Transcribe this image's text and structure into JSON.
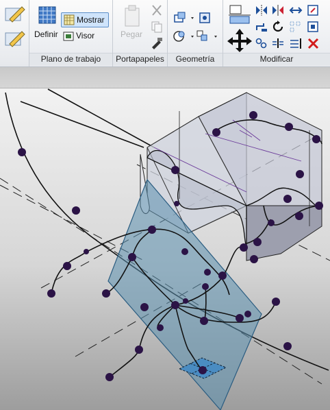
{
  "ribbon": {
    "panels": {
      "workplane": {
        "label": "Plano de trabajo",
        "define_label": "Definir",
        "show_label": "Mostrar",
        "viewer_label": "Visor"
      },
      "clipboard": {
        "label": "Portapapeles",
        "paste_label": "Pegar"
      },
      "geometry": {
        "label": "Geometría"
      },
      "modify": {
        "label": "Modificar"
      }
    }
  },
  "icons": [
    "grid-workplane-icon",
    "show-workplane-icon",
    "viewer-icon",
    "paste-icon",
    "cut-icon",
    "copy-icon",
    "match-type-icon",
    "join-geometry-icon",
    "cut-geometry-icon",
    "align-icon",
    "offset-icon",
    "mirror-icon",
    "move-icon",
    "rotate-icon",
    "trim-icon",
    "split-icon",
    "delete-icon"
  ],
  "colors": {
    "ribbon_bg": "#eef0f3",
    "selection_blue": "#cfe4fb",
    "plane_fill": "#5b8fae",
    "node_color": "#2b1346"
  }
}
